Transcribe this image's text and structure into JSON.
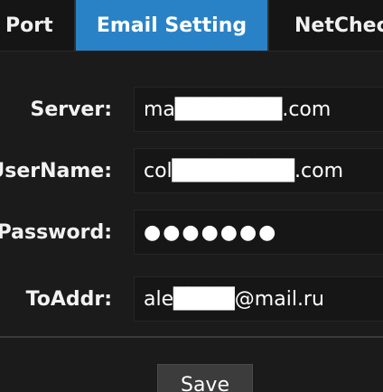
{
  "tabs": [
    {
      "label": "Port",
      "active": false
    },
    {
      "label": "Email Setting",
      "active": true
    },
    {
      "label": "NetChec",
      "active": false
    }
  ],
  "form": {
    "server": {
      "label": "Server:",
      "value": "ma███████.com"
    },
    "username": {
      "label": "UserName:",
      "value": "col████████.com"
    },
    "password": {
      "label": "Password:",
      "value": "●●●●●●●"
    },
    "toaddr": {
      "label": "ToAddr:",
      "value": "ale████@mail.ru"
    }
  },
  "actions": {
    "save_label": "Save"
  },
  "colors": {
    "active_tab": "#2a82c6",
    "background": "#1b1b1b",
    "field_background": "#161616"
  }
}
